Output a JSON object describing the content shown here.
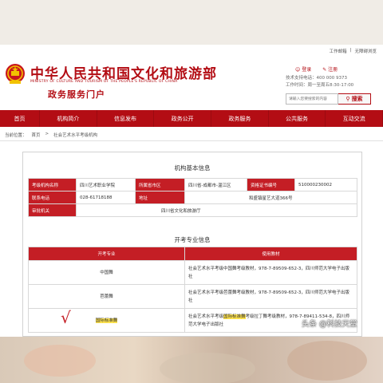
{
  "utility": [
    "工作邮箱",
    "无障碍浏览"
  ],
  "header": {
    "title": "中华人民共和国文化和旅游部",
    "subtitle_en": "MINISTRY OF CULTURE AND TOURISM OF THE PEOPLE'S REPUBLIC OF CHINA",
    "portal": "政务服务门户",
    "login": "登录",
    "register": "注册",
    "hotline": "技术支持电话：400 000 9373",
    "hours": "工作时间：周一至周五8:30-17:00",
    "search_placeholder": "请输入您要搜索的内容",
    "search_button": "搜索"
  },
  "nav": [
    "首页",
    "机构简介",
    "信息发布",
    "政务公开",
    "政务服务",
    "公共服务",
    "互动交流"
  ],
  "breadcrumb": [
    "当前位置：",
    "首页",
    ">",
    "社会艺术水平考级机构"
  ],
  "basic_info": {
    "title": "机构基本信息",
    "rows": [
      [
        "考级机构名称",
        "四川艺术职业学院",
        "所属省市区",
        "四川省-成都市-温江区",
        "资格证书编号",
        "510000230002"
      ],
      [
        "联系电话",
        "028-61718188",
        "地址",
        "和盛镇星艺大道366号"
      ],
      [
        "审批机关",
        "四川省文化和旅游厅"
      ]
    ]
  },
  "majors": {
    "title": "开考专业信息",
    "headers": [
      "开考专业",
      "使用教材"
    ],
    "rows": [
      {
        "major": "中国舞",
        "material": "社会艺术水平考级中国舞考级教材，978-7-89509-652-3，四川师范大学电子出版社"
      },
      {
        "major": "芭蕾舞",
        "material": "社会艺术水平考级芭蕾舞考级教材，978-7-89509-652-3，四川师范大学电子出版社"
      },
      {
        "major": "国际标准舞",
        "material_pre": "社会艺术水平考级",
        "material_hl": "国际标准舞",
        "material_post": "考级拉丁舞考级教材，978-7-89411-534-8，四川师范大学电子出版社"
      }
    ]
  },
  "checkmark": "√",
  "watermark": "头条 @科技天堂",
  "colors": {
    "brand_red": "#b30d14",
    "label_red": "#c41e25",
    "highlight": "#ffe34d"
  }
}
